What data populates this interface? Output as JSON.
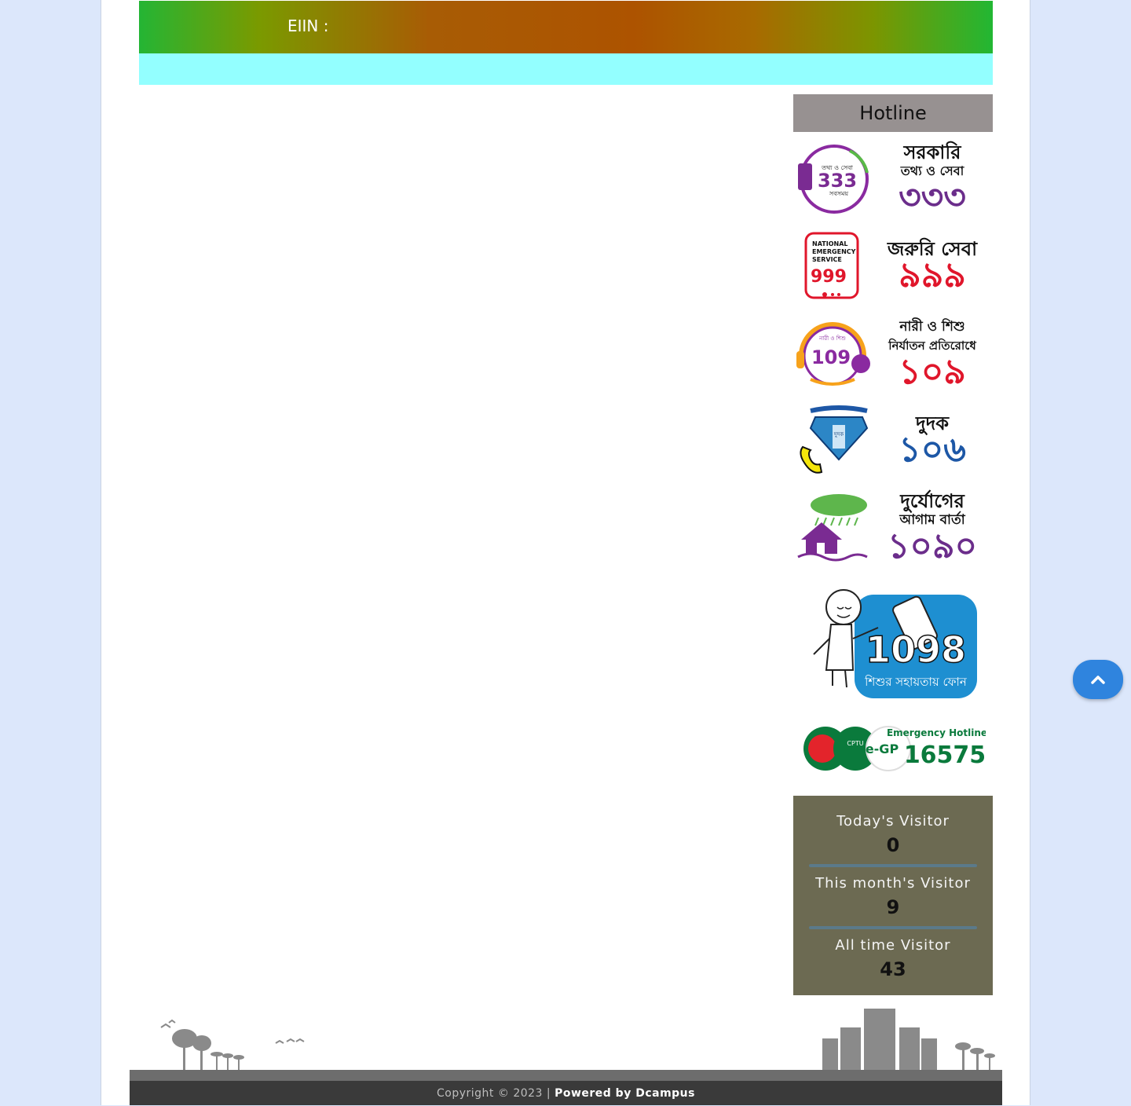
{
  "header": {
    "eiin_label": "EIIN :"
  },
  "sidebar": {
    "hotline_title": "Hotline",
    "hotlines": [
      {
        "logo_text": "333",
        "logo_caption": "তথ্য ও সেবা",
        "logo_sub": "সবসময়",
        "title": "সরকারি",
        "subtitle": "তথ্য ও সেবা",
        "number": "৩৩৩",
        "color": "#6b2d8b"
      },
      {
        "logo_text": "999",
        "logo_caption": "NATIONAL EMERGENCY SERVICE",
        "title": "জরুরি সেবা",
        "subtitle": "",
        "number": "৯৯৯",
        "color": "#e0162b"
      },
      {
        "logo_text": "109",
        "logo_caption": "নারী ও শিশু",
        "title": "নারী ও শিশু",
        "subtitle": "নির্যাতন প্রতিরোধে",
        "number": "১০৯",
        "color": "#e0162b"
      },
      {
        "logo_text": "দুদক",
        "logo_caption": "",
        "title": "দুদক",
        "subtitle": "",
        "number": "১০৬",
        "color": "#1d57a6"
      },
      {
        "logo_text": "",
        "logo_caption": "",
        "title": "দুর্যোগের",
        "subtitle": "আগাম বার্তা",
        "number": "১০৯০",
        "color": "#6b2d8b"
      }
    ],
    "child_helpline": {
      "number": "1098",
      "caption": "শিশুর সহায়তায় ফোন"
    },
    "egp": {
      "title": "Emergency Hotline",
      "number": "16575",
      "logo": "e-GP",
      "cptu": "CPTU"
    }
  },
  "visitors": {
    "today_label": "Today's Visitor",
    "today_value": "0",
    "month_label": "This month's Visitor",
    "month_value": "9",
    "all_label": "All time Visitor",
    "all_value": "43"
  },
  "footer": {
    "copyright": "Copyright © 2023 |",
    "powered": "Powered by Dcampus"
  },
  "icons": {
    "scroll_top": "chevron-up-icon"
  },
  "colors": {
    "accent": "#2f84de",
    "visitor_bg": "#6c6a52",
    "nav_band": "#93ffff",
    "hotline_header": "#979191"
  }
}
